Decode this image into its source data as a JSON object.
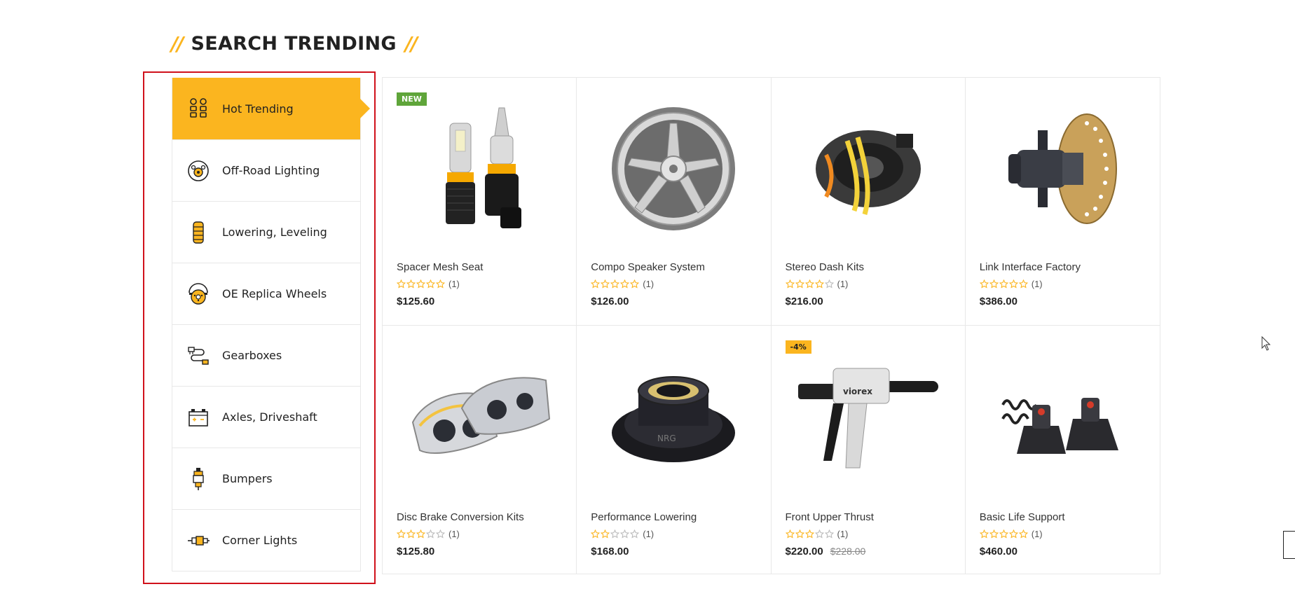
{
  "section": {
    "title": "SEARCH TRENDING",
    "slash_left": "//",
    "slash_right": "//"
  },
  "colors": {
    "accent": "#fbb51f",
    "frame": "#d0111b",
    "badge_new": "#5fa53a"
  },
  "sidebar": {
    "items": [
      {
        "label": "Hot Trending",
        "icon": "hot-trending-icon",
        "active": true
      },
      {
        "label": "Off-Road Lighting",
        "icon": "off-road-lighting-icon",
        "active": false
      },
      {
        "label": "Lowering, Leveling",
        "icon": "spring-icon",
        "active": false
      },
      {
        "label": "OE Replica Wheels",
        "icon": "wheel-icon",
        "active": false
      },
      {
        "label": "Gearboxes",
        "icon": "gearbox-icon",
        "active": false
      },
      {
        "label": "Axles, Driveshaft",
        "icon": "battery-icon",
        "active": false
      },
      {
        "label": "Bumpers",
        "icon": "spark-plug-icon",
        "active": false
      },
      {
        "label": "Corner Lights",
        "icon": "corner-light-icon",
        "active": false
      }
    ]
  },
  "products": [
    {
      "name": "Spacer Mesh Seat",
      "rating": 5,
      "reviews": "(1)",
      "price": "$125.60",
      "old_price": "",
      "badge": "NEW",
      "image": "headlight-bulb-image"
    },
    {
      "name": "Compo Speaker System",
      "rating": 5,
      "reviews": "(1)",
      "price": "$126.00",
      "old_price": "",
      "badge": "",
      "image": "chrome-wheel-image"
    },
    {
      "name": "Stereo Dash Kits",
      "rating": 4,
      "reviews": "(1)",
      "price": "$216.00",
      "old_price": "",
      "badge": "",
      "image": "clock-spring-image"
    },
    {
      "name": "Link Interface Factory",
      "rating": 5,
      "reviews": "(1)",
      "price": "$386.00",
      "old_price": "",
      "badge": "",
      "image": "brake-hub-image"
    },
    {
      "name": "Disc Brake Conversion Kits",
      "rating": 3,
      "reviews": "(1)",
      "price": "$125.80",
      "old_price": "",
      "badge": "",
      "image": "headlights-image"
    },
    {
      "name": "Performance Lowering",
      "rating": 2,
      "reviews": "(1)",
      "price": "$168.00",
      "old_price": "",
      "badge": "",
      "image": "quick-release-image"
    },
    {
      "name": "Front Upper Thrust",
      "rating": 3,
      "reviews": "(1)",
      "price": "$220.00",
      "old_price": "$228.00",
      "badge": "-4%",
      "image": "dispenser-gun-image"
    },
    {
      "name": "Basic Life Support",
      "rating": 5,
      "reviews": "(1)",
      "price": "$460.00",
      "old_price": "",
      "badge": "",
      "image": "remote-switch-image"
    }
  ]
}
